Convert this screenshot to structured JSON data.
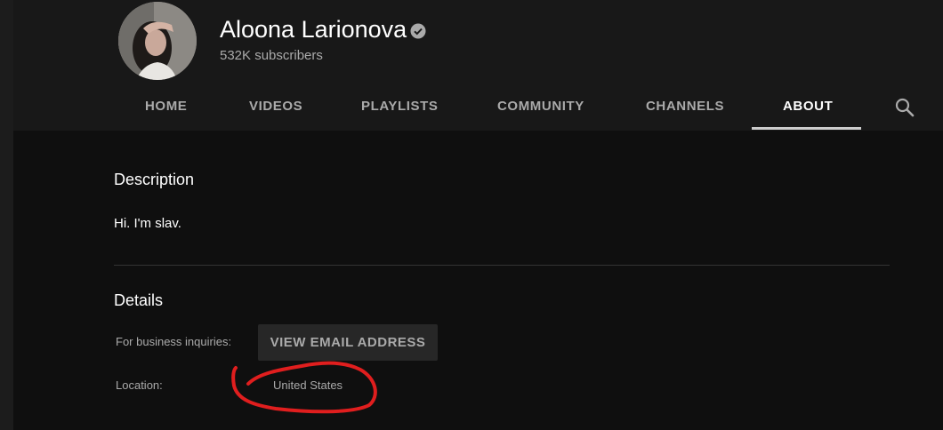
{
  "channel": {
    "name": "Aloona Larionova",
    "subscribers": "532K subscribers"
  },
  "tabs": [
    {
      "label": "HOME"
    },
    {
      "label": "VIDEOS"
    },
    {
      "label": "PLAYLISTS"
    },
    {
      "label": "COMMUNITY"
    },
    {
      "label": "CHANNELS"
    },
    {
      "label": "ABOUT",
      "active": true
    }
  ],
  "about": {
    "description_title": "Description",
    "description_text": "Hi. I'm slav.",
    "details_title": "Details",
    "business_label": "For business inquiries:",
    "email_button": "VIEW EMAIL ADDRESS",
    "location_label": "Location:",
    "location_value": "United States"
  },
  "colors": {
    "background": "#0f0f0f",
    "header": "#181818",
    "annotation": "#e01e1e"
  },
  "icons": {
    "verified": "verified-check-icon",
    "search": "search-icon"
  }
}
